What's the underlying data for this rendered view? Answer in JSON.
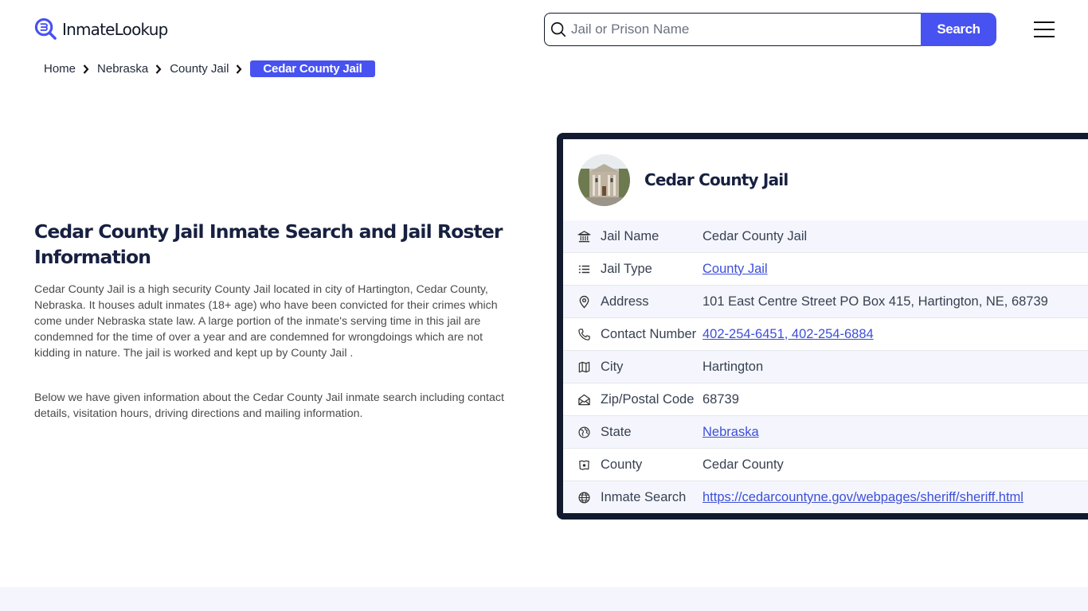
{
  "header": {
    "logo_text": "InmateLookup",
    "search_placeholder": "Jail or Prison Name",
    "search_value": "",
    "search_button": "Search",
    "brand_color": "#4752f0"
  },
  "breadcrumb": [
    {
      "label": "Home"
    },
    {
      "label": "Nebraska"
    },
    {
      "label": "County Jail"
    },
    {
      "label": "Cedar County Jail",
      "active": true
    }
  ],
  "main": {
    "title": "Cedar County Jail Inmate Search and Jail Roster Information",
    "paragraphs": [
      "Cedar County Jail is a high security County Jail located in city of Hartington, Cedar County, Nebraska. It houses adult inmates (18+ age) who have been convicted for their crimes which come under Nebraska state law. A large portion of the inmate's serving time in this jail are condemned for the time of over a year and are condemned for wrongdoings which are not kidding in nature. The jail is worked and kept up by County Jail .",
      "Below we have given information about the Cedar County Jail inmate search including contact details, visitation hours, driving directions and mailing information."
    ]
  },
  "card": {
    "title": "Cedar County Jail",
    "avatar_alt": "courthouse-photo",
    "rows": [
      {
        "icon": "building-columns-icon",
        "label": "Jail Name",
        "value": "Cedar County Jail",
        "link": false
      },
      {
        "icon": "list-icon",
        "label": "Jail Type",
        "value": "County Jail",
        "link": true
      },
      {
        "icon": "map-pin-icon",
        "label": "Address",
        "value": "101 East Centre Street PO Box 415, Hartington, NE, 68739",
        "link": false
      },
      {
        "icon": "phone-icon",
        "label": "Contact Number",
        "value": "402-254-6451, 402-254-6884",
        "link": true
      },
      {
        "icon": "map-icon",
        "label": "City",
        "value": "Hartington",
        "link": false
      },
      {
        "icon": "mail-open-icon",
        "label": "Zip/Postal Code",
        "value": "68739",
        "link": false
      },
      {
        "icon": "globe-region-icon",
        "label": "State",
        "value": "Nebraska",
        "link": true
      },
      {
        "icon": "county-map-icon",
        "label": "County",
        "value": "Cedar County",
        "link": false
      },
      {
        "icon": "globe-icon",
        "label": "Inmate Search",
        "value": "https://cedarcountyne.gov/webpages/sheriff/sheriff.html",
        "link": true
      }
    ]
  }
}
